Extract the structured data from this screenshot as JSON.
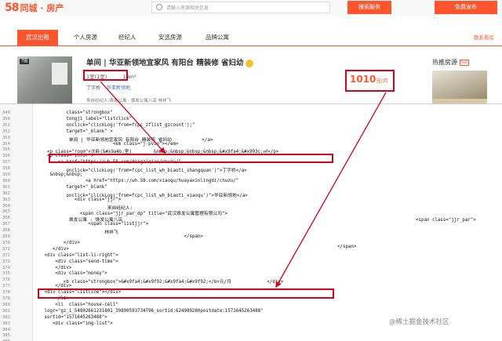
{
  "header": {
    "logo_num": "58",
    "logo_text": "同城 · 房产",
    "search_placeholder": "请输入房源相关信息",
    "search_button": "搜索服务",
    "publish_button": "免费发布"
  },
  "nav": {
    "tabs": [
      "武汉出租",
      "个人房源",
      "经纪人",
      "安选房源",
      "品牌公寓"
    ],
    "right_link": "联系看房"
  },
  "listing": {
    "thumb_tag": "7图",
    "title": "单间 | 华亚新领地宜家风 有阳台 精装修 省妇幼",
    "room": "1室(1室)",
    "size": "14m²",
    "community": "丁字桥",
    "sub_community": "华亚新领地",
    "agent": "来自经纪人:焕发公寓 - 焕发公寓八店 林祥飞",
    "price": "1010",
    "price_unit": "元/月"
  },
  "sidebar": {
    "hot_title": "热推房源",
    "hot_badge": "hot"
  },
  "source": {
    "line_numbers": [
      "349",
      "350",
      "351",
      "352",
      "353",
      "354",
      "355",
      "356",
      "357",
      "358",
      "359",
      "360",
      "361",
      "362",
      "363",
      "364",
      "365",
      "366",
      "367",
      "368",
      "369",
      "370",
      "371",
      "372",
      "373",
      "374",
      "375",
      "376",
      "377",
      "378",
      "379",
      "380",
      "381",
      "382",
      "383",
      "384",
      "385",
      "386"
    ],
    "lines": [
      "           class=\"strongbox\"",
      "           tongji_label=\"listclick\"",
      "           onclick=\"clickLog('from=fcpc_zflist_gzcount');\"",
      "           target=\"_blank\" >",
      "            单间 | 华亚新领地宜家风 有阳台 精装修 省妇幼           </a>",
      "                            <em class=\"j-pvio\"></em>",
      "    <p class=\"room\">次卧(&#x9a4b;室)        &nbsp;&nbsp;&nbsp;&nbsp;&#x9fa4;&#x993c;㎡</p>",
      "    <p class=\"infor\">",
      "        <a href=\"https://wh.58.com/dingziqiao/chuzu/\"",
      "           onclick=\"clickLog('from=fcpc_list_wh_biaoti_shangquan')\">丁字桥</a>",
      "     &nbsp;&nbsp;",
      "                  <a href=\"https://wh.58.com/xiaoqu/huayaxinlingdi/chuzu/\"",
      "           target=\"_blank\"",
      "           onclick=\"clickLog('from=fcpc_list_wh_biaoti_xiaoqu')\">华亚新领地</a>",
      "              <div class=\"jjr\">",
      "                          来自经纪人:",
      "                <span class=\"jjr_par_dp\" title=\"武汉焕发公寓管理有限公司\">",
      "            焕发公寓 - 焕发公寓八店",
      "                   <span class=\"listjjr\">",
      "                         林祥飞",
      "                                                      </span>",
      "          </div>",
      "      </div>",
      "   <div class=\"list-li-right\">",
      "       <div class=\"send-time\">",
      "       </div>",
      "       <div class=\"money\">",
      "          <b class=\"strongbox\">&#x9fa4;&#x9f92;&#x9fa4;&#x9f92;</b>元/月             </div>",
      "       </div>",
      "   <div class=\"listline\"></div>",
      "       </li>",
      "       <li  class=\"house-cell\"",
      "   logr=\"gz_1_54802661231801_39890593734796_sortid:624989280postdate:1571645263488\"",
      "   sortid=\"1571645263488\">",
      "      <div class=\"img-list\">",
      "",
      "",
      ""
    ],
    "side_span": "<span class=\"jjr_par\">",
    "side_span_close": "</span>"
  },
  "watermark": "@稀土掘金技术社区",
  "colors": {
    "brand": "#ff552e",
    "annotation": "#d9001b"
  }
}
